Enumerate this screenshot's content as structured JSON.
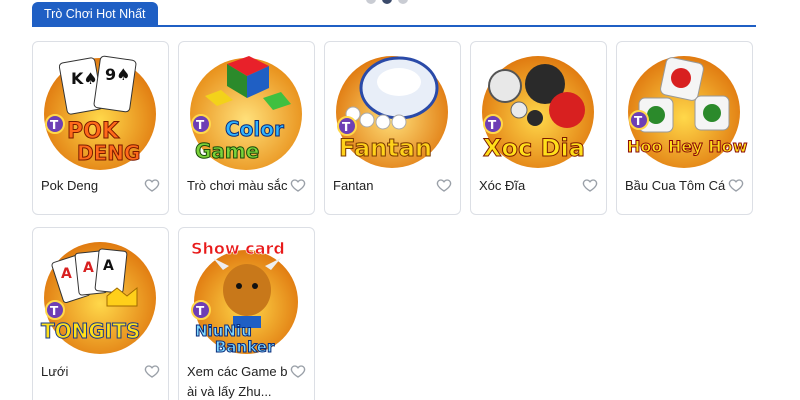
{
  "section": {
    "tab_label": "Trò Chơi Hot Nhất"
  },
  "carousel": {
    "dots": 3,
    "active_index": 1
  },
  "games": [
    {
      "title": "Pok Deng",
      "thumb_text": [
        "POK",
        "DENG"
      ],
      "icon": "pok-deng-thumbnail"
    },
    {
      "title": "Trò chơi màu sắc",
      "thumb_text": [
        "Color",
        "Game"
      ],
      "icon": "color-game-thumbnail"
    },
    {
      "title": "Fantan",
      "thumb_text": [
        "Fantan"
      ],
      "icon": "fantan-thumbnail"
    },
    {
      "title": "Xóc Đĩa",
      "thumb_text": [
        "Xoc Dia"
      ],
      "icon": "xoc-dia-thumbnail"
    },
    {
      "title": "Bầu Cua Tôm Cá",
      "thumb_text": [
        "Hoo Hey How"
      ],
      "icon": "hoo-hey-how-thumbnail"
    },
    {
      "title": "Lưới",
      "thumb_text": [
        "TONGITS"
      ],
      "icon": "tongits-thumbnail"
    },
    {
      "title": "Xem các Game bài và lấy Zhu...",
      "thumb_text": [
        "Show card",
        "NiuNiu",
        "Banker"
      ],
      "icon": "niuniu-banker-thumbnail"
    }
  ],
  "thumb_badge": "T",
  "colors": {
    "accent": "#1f5fc4",
    "card_border": "#dcdfe5",
    "heart": "#9aa0a8"
  }
}
